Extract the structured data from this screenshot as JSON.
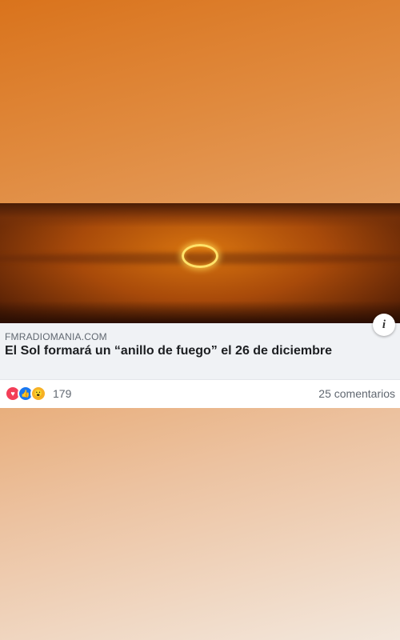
{
  "post": {
    "source": "FMRADIOMANIA.COM",
    "headline": "El Sol formará un “anillo de fuego” el 26 de diciembre",
    "info_icon": "i",
    "reactions": {
      "icons": [
        "love-icon",
        "like-icon",
        "wow-icon"
      ],
      "count": "179"
    },
    "comments": "25 comentarios"
  }
}
